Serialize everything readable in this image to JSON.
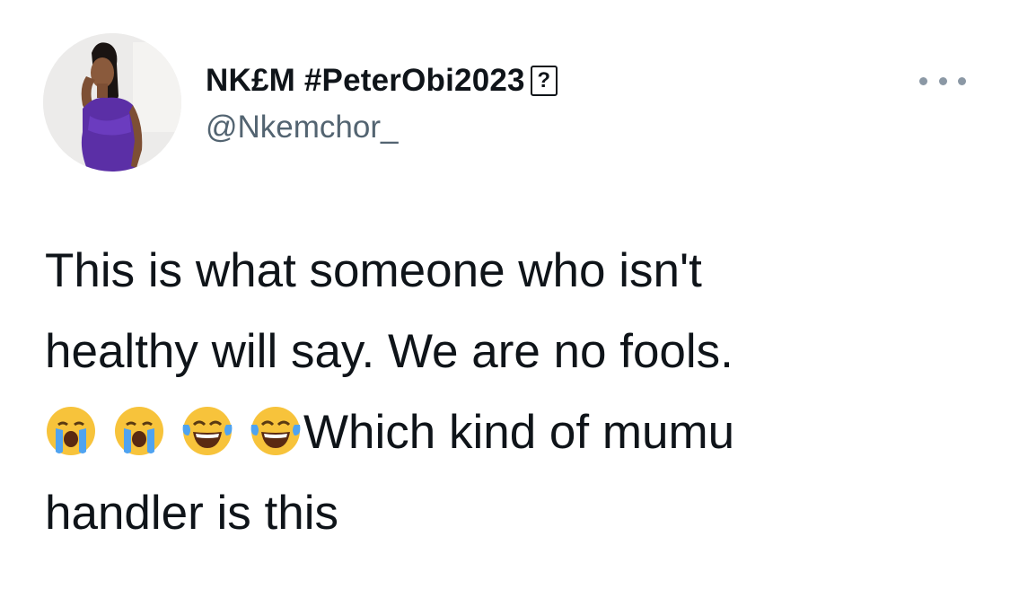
{
  "tweet": {
    "author": {
      "display_name": "NK£M #PeterObi2023",
      "unsupported_glyph": "?",
      "handle": "@Nkemchor_"
    },
    "body": {
      "line1": "This is what someone who isn't",
      "line2": "healthy will say. We are no fools.",
      "line3": "Which kind of mumu",
      "line4": "handler is this"
    },
    "emojis": [
      "loudly-crying-face",
      "loudly-crying-face",
      "face-with-tears-of-joy",
      "face-with-tears-of-joy"
    ]
  },
  "colors": {
    "text": "#0f1419",
    "secondary": "#536471",
    "more_dots": "#8b98a5",
    "emoji_yellow": "#f7c33b",
    "emoji_blue": "#4fa3f0"
  }
}
